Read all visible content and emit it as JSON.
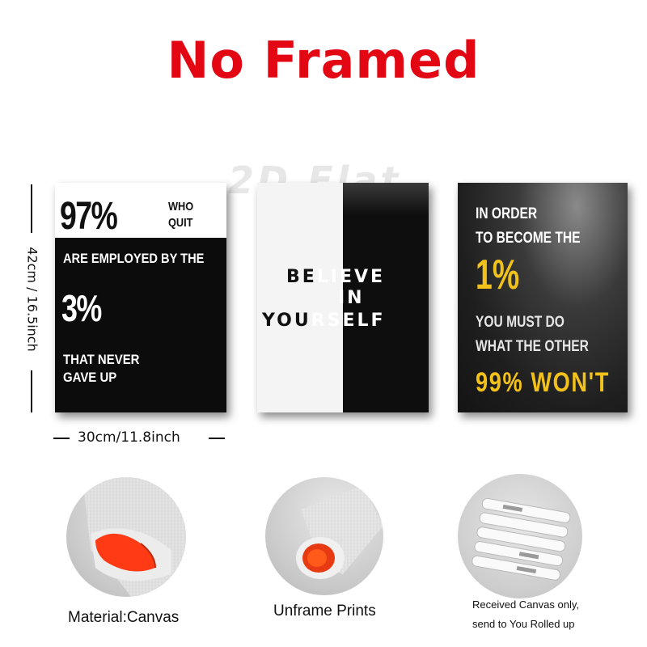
{
  "title": {
    "text": "No Framed",
    "color": "#e30613"
  },
  "watermark": "2D Flat",
  "posters": [
    {
      "big_top": "97%",
      "side_text": "WHO QUIT",
      "line_2": "ARE EMPLOYED BY THE",
      "big_mid": "3%",
      "line_3": "THAT NEVER GAVE UP"
    },
    {
      "line_1_dark": "BE",
      "line_1_light": "LIEVE",
      "line_2": "IN",
      "line_3_dark": "YOU",
      "line_3_light": "RSELF"
    },
    {
      "line_1": "IN ORDER",
      "line_1b": "TO BECOME THE",
      "big": "1%",
      "line_2": "YOU MUST DO",
      "line_2b": "WHAT THE OTHER",
      "line_3": "99% WON'T",
      "accent_color": "#f2c21b"
    }
  ],
  "dimensions": {
    "height_label": "42cm / 16.5inch",
    "width_label": "30cm/11.8inch"
  },
  "features": [
    {
      "icon": "canvas-roll-icon",
      "caption": "Material:Canvas"
    },
    {
      "icon": "rolled-print-icon",
      "caption": "Unframe  Prints"
    },
    {
      "icon": "rolled-packages-icon",
      "caption_line1": "Received Canvas only,",
      "caption_line2": "send to You Rolled up"
    }
  ]
}
